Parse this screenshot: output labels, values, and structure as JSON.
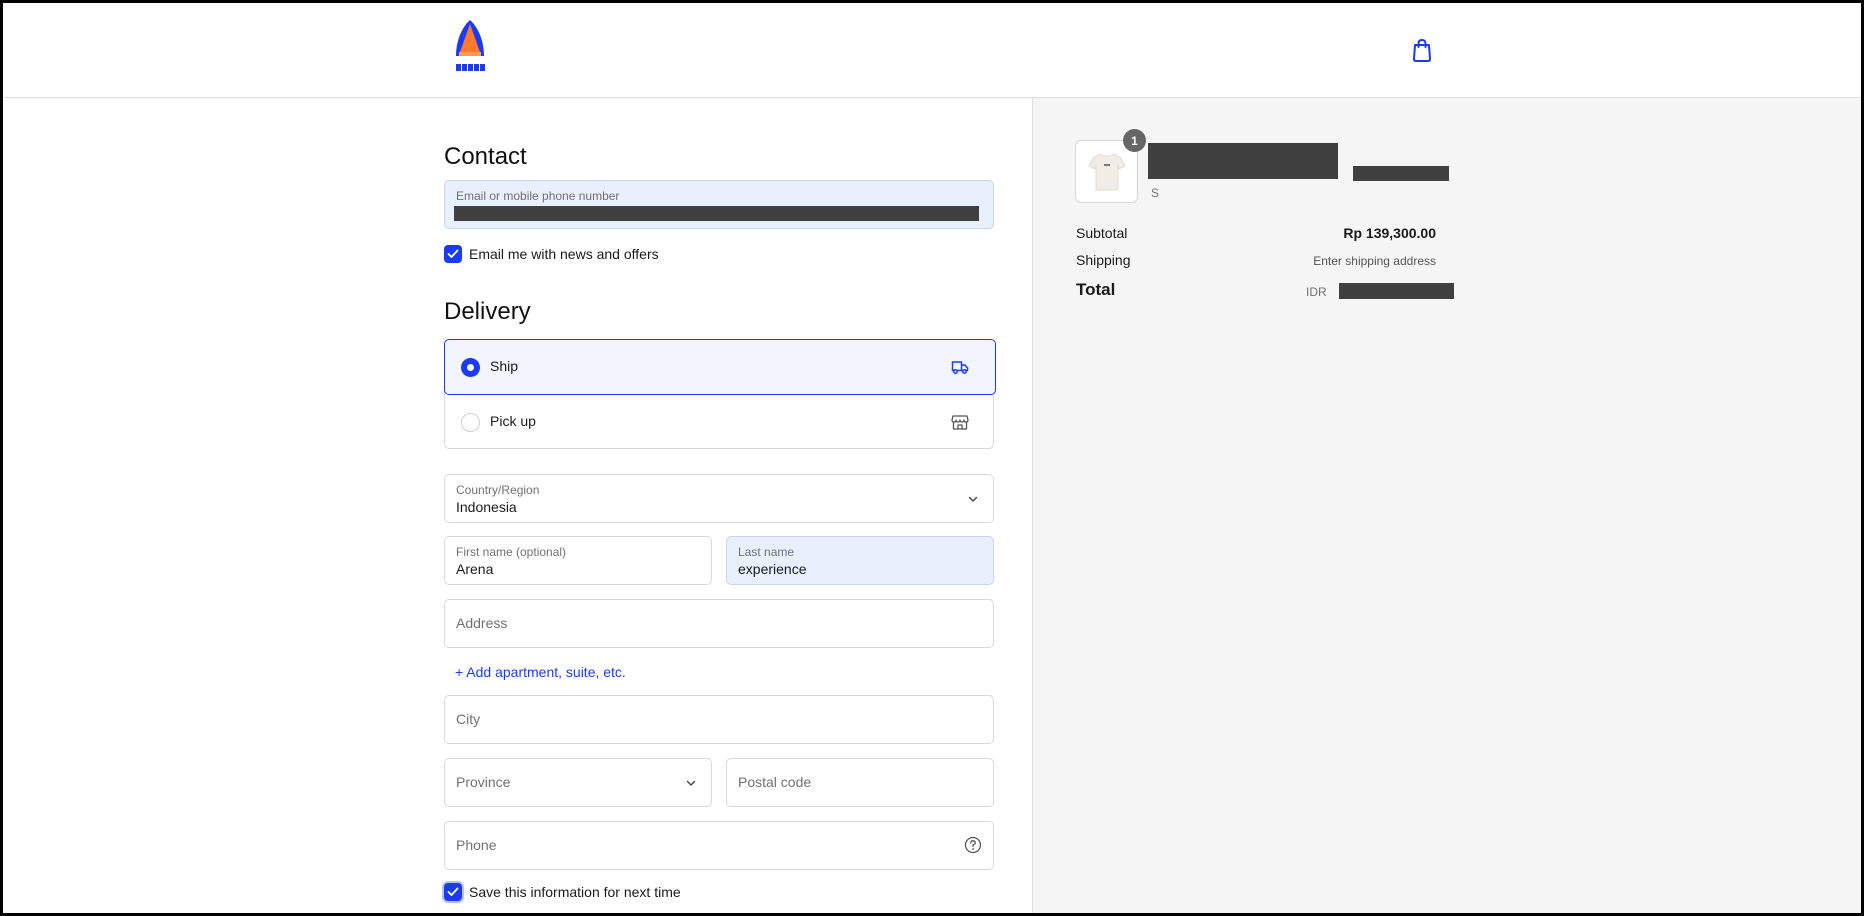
{
  "header": {
    "logo_alt": "ARENA",
    "cart_icon": "shopping-bag-icon"
  },
  "contact": {
    "heading": "Contact",
    "email_label": "Email or mobile phone number",
    "newsletter_label": "Email me with news and offers",
    "newsletter_checked": true
  },
  "delivery": {
    "heading": "Delivery",
    "options": [
      {
        "label": "Ship",
        "selected": true,
        "icon": "truck-icon"
      },
      {
        "label": "Pick up",
        "selected": false,
        "icon": "store-icon"
      }
    ],
    "country_label": "Country/Region",
    "country_value": "Indonesia",
    "first_name_label": "First name (optional)",
    "first_name_value": "Arena",
    "last_name_label": "Last name",
    "last_name_value": "experience",
    "address_placeholder": "Address",
    "add_apartment_link": "+ Add apartment, suite, etc.",
    "city_placeholder": "City",
    "province_placeholder": "Province",
    "postal_placeholder": "Postal code",
    "phone_placeholder": "Phone",
    "save_info_label": "Save this information for next time",
    "save_info_checked": true
  },
  "summary": {
    "quantity": "1",
    "variant": "S",
    "subtotal_label": "Subtotal",
    "subtotal_value": "Rp 139,300.00",
    "shipping_label": "Shipping",
    "shipping_value": "Enter shipping address",
    "total_label": "Total",
    "total_currency": "IDR"
  },
  "colors": {
    "accent": "#1b3bf0",
    "summary_bg": "#f5f5f5",
    "autofill_bg": "#e8f0fd"
  }
}
